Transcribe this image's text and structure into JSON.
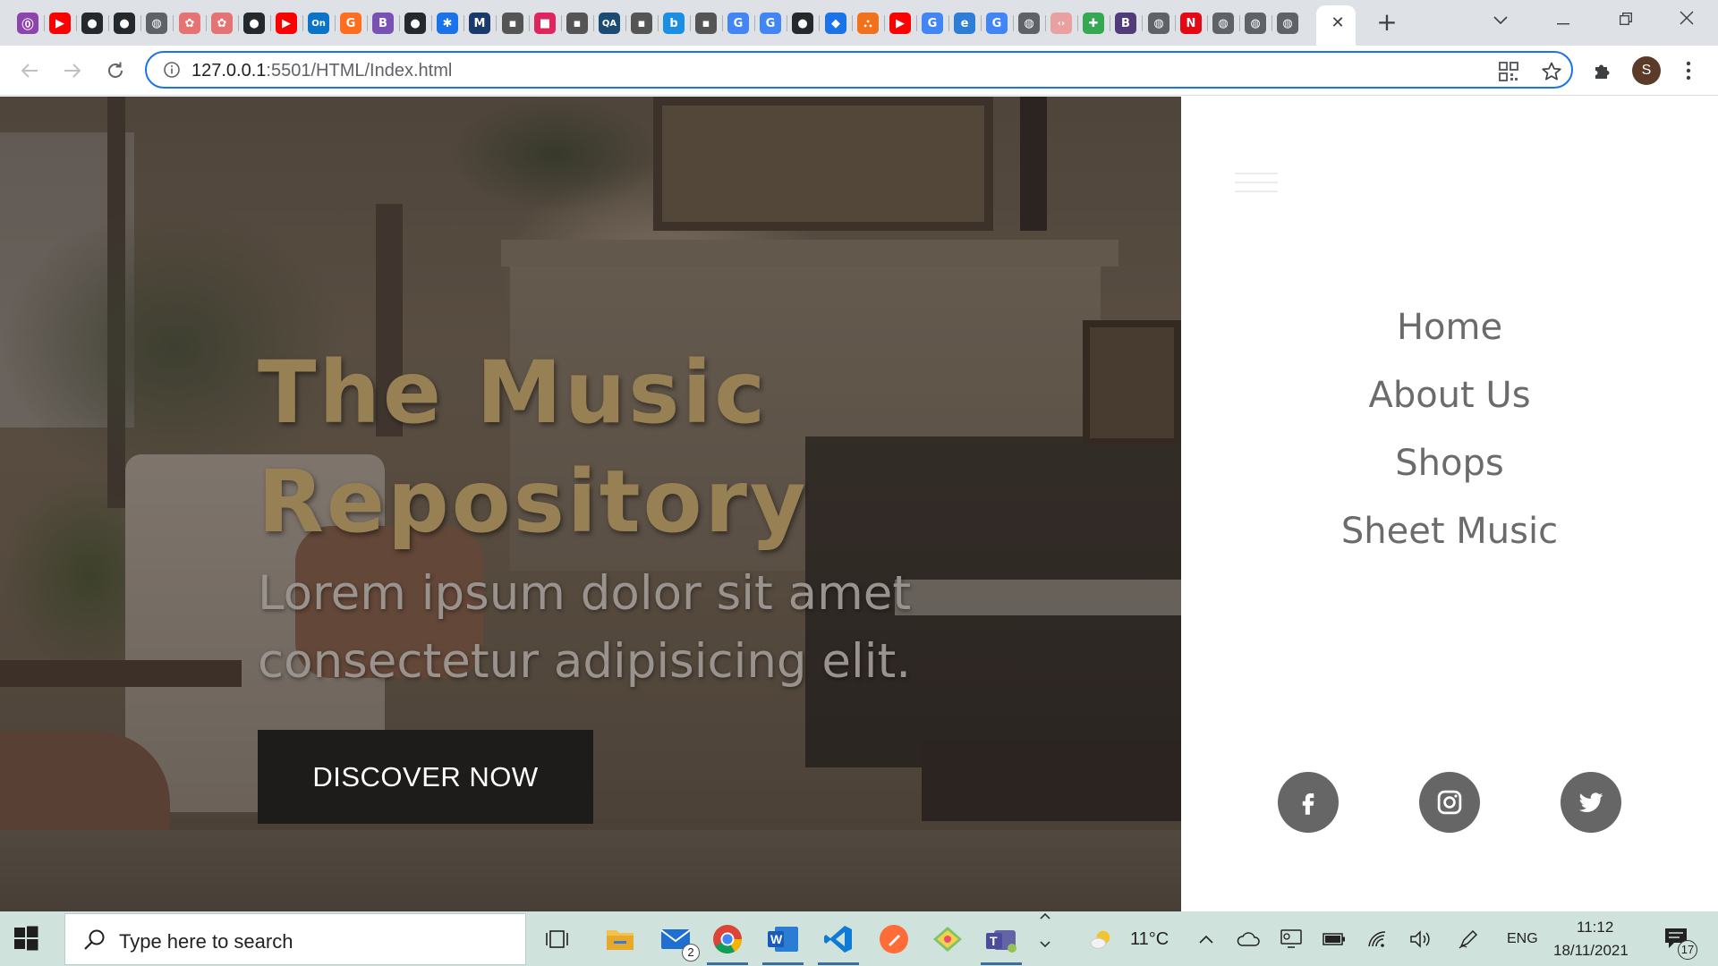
{
  "browser": {
    "url_host": "127.0.0.1",
    "url_rest": ":5501/HTML/Index.html",
    "active_tab_close": "✕",
    "new_tab": "+",
    "profile_initial": "S",
    "tab_favicons": [
      {
        "icon": "cortex-icon",
        "glyph": "⓪",
        "color": "#8e44ad"
      },
      {
        "icon": "youtube-icon",
        "glyph": "▶",
        "color": "#ff0000"
      },
      {
        "icon": "github-icon",
        "glyph": "●",
        "color": "#24292e"
      },
      {
        "icon": "github-icon",
        "glyph": "●",
        "color": "#24292e"
      },
      {
        "icon": "globe-icon",
        "glyph": "◍",
        "color": "#5f6368"
      },
      {
        "icon": "openai-icon",
        "glyph": "✿",
        "color": "#e57373"
      },
      {
        "icon": "openai-icon",
        "glyph": "✿",
        "color": "#e57373"
      },
      {
        "icon": "github-icon",
        "glyph": "●",
        "color": "#24292e"
      },
      {
        "icon": "youtube-icon",
        "glyph": "▶",
        "color": "#ff0000"
      },
      {
        "icon": "on-icon",
        "glyph": "On",
        "color": "#0a74c9"
      },
      {
        "icon": "g-orange-icon",
        "glyph": "G",
        "color": "#ff6d1f"
      },
      {
        "icon": "bootstrap-icon",
        "glyph": "B",
        "color": "#7952b3"
      },
      {
        "icon": "github-icon",
        "glyph": "●",
        "color": "#24292e"
      },
      {
        "icon": "gear-icon",
        "glyph": "✱",
        "color": "#1a73e8"
      },
      {
        "icon": "mdn-icon",
        "glyph": "M",
        "color": "#1a3a6e"
      },
      {
        "icon": "dots-icon",
        "glyph": "▪",
        "color": "#555555"
      },
      {
        "icon": "pink-square-icon",
        "glyph": "■",
        "color": "#e0245e"
      },
      {
        "icon": "dots-icon",
        "glyph": "▪",
        "color": "#555555"
      },
      {
        "icon": "qa-icon",
        "glyph": "QA",
        "color": "#1b4b72"
      },
      {
        "icon": "dots-icon",
        "glyph": "▪",
        "color": "#555555"
      },
      {
        "icon": "bing-icon",
        "glyph": "b",
        "color": "#1a8fe3"
      },
      {
        "icon": "dots-icon",
        "glyph": "▪",
        "color": "#555555"
      },
      {
        "icon": "google-icon",
        "glyph": "G",
        "color": "#4285f4"
      },
      {
        "icon": "google-icon",
        "glyph": "G",
        "color": "#4285f4"
      },
      {
        "icon": "github-icon",
        "glyph": "●",
        "color": "#24292e"
      },
      {
        "icon": "diamond-icon",
        "glyph": "◆",
        "color": "#1a73e8"
      },
      {
        "icon": "ok-icon",
        "glyph": "⛬",
        "color": "#f2711c"
      },
      {
        "icon": "youtube-icon",
        "glyph": "▶",
        "color": "#ff0000"
      },
      {
        "icon": "google-icon",
        "glyph": "G",
        "color": "#4285f4"
      },
      {
        "icon": "edge-icon",
        "glyph": "e",
        "color": "#2e7dd7"
      },
      {
        "icon": "google-icon",
        "glyph": "G",
        "color": "#4285f4"
      },
      {
        "icon": "globe-icon",
        "glyph": "◍",
        "color": "#5f6368"
      },
      {
        "icon": "code-icon",
        "glyph": "‹›",
        "color": "#e8a0a0"
      },
      {
        "icon": "puzzle-color-icon",
        "glyph": "✚",
        "color": "#34a853"
      },
      {
        "icon": "bootstrap-dark-icon",
        "glyph": "B",
        "color": "#503c7a"
      },
      {
        "icon": "globe-icon",
        "glyph": "◍",
        "color": "#5f6368"
      },
      {
        "icon": "netflix-icon",
        "glyph": "N",
        "color": "#e50914"
      },
      {
        "icon": "globe-icon",
        "glyph": "◍",
        "color": "#5f6368"
      },
      {
        "icon": "globe-icon",
        "glyph": "◍",
        "color": "#5f6368"
      },
      {
        "icon": "globe-icon",
        "glyph": "◍",
        "color": "#5f6368"
      }
    ]
  },
  "page": {
    "hero": {
      "title_line1": "The Music",
      "title_line2": "Repository",
      "subtitle_line1": "Lorem ipsum dolor sit amet",
      "subtitle_line2": "consectetur adipisicing elit.",
      "cta_label": "DISCOVER NOW",
      "title_color": "#978154"
    },
    "menu": {
      "items": [
        {
          "label": "Home"
        },
        {
          "label": "About Us"
        },
        {
          "label": "Shops"
        },
        {
          "label": "Sheet Music"
        }
      ]
    },
    "socials": [
      {
        "icon": "facebook-icon"
      },
      {
        "icon": "instagram-icon"
      },
      {
        "icon": "twitter-icon"
      }
    ]
  },
  "taskbar": {
    "search_placeholder": "Type here to search",
    "mail_badge": "2",
    "weather": "11°C",
    "language": "ENG",
    "time": "11:12",
    "date": "18/11/2021",
    "notifications": "17",
    "apps": [
      {
        "icon": "task-view-icon"
      },
      {
        "icon": "file-explorer-icon"
      },
      {
        "icon": "mail-icon"
      },
      {
        "icon": "chrome-icon"
      },
      {
        "icon": "word-icon"
      },
      {
        "icon": "vscode-icon"
      },
      {
        "icon": "postman-icon"
      },
      {
        "icon": "git-icon"
      },
      {
        "icon": "teams-icon"
      }
    ]
  }
}
